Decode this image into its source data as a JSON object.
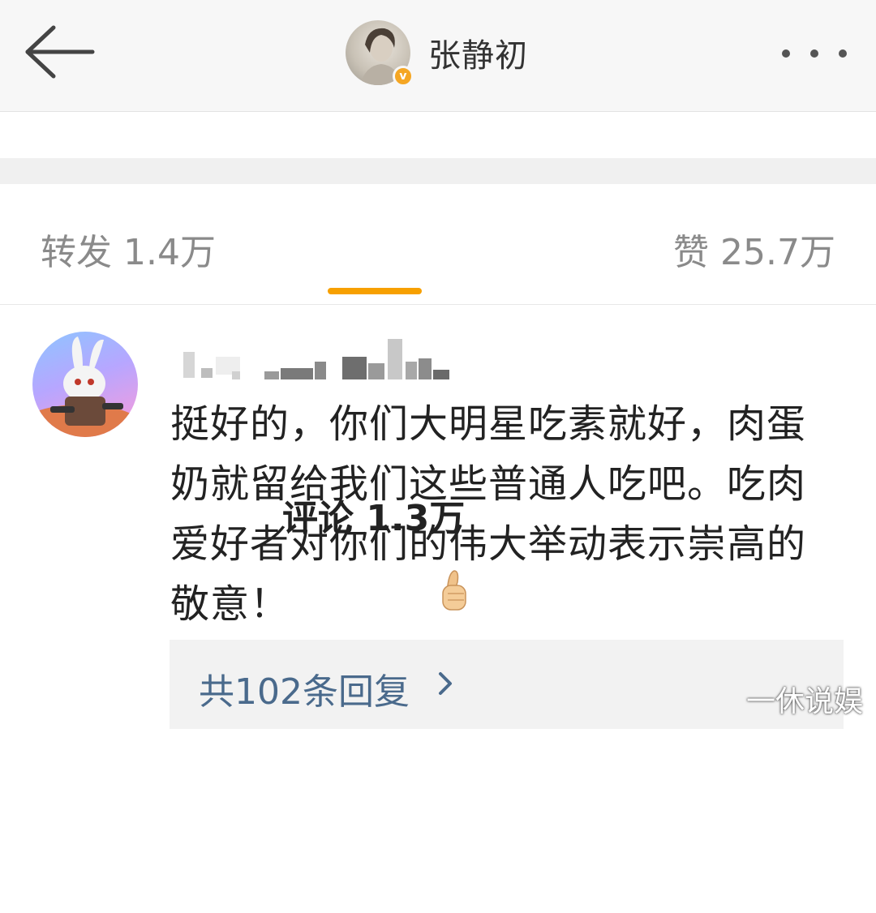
{
  "header": {
    "user_name": "张静初",
    "verified_mark": "v"
  },
  "tabs": {
    "repost": "转发 1.4万",
    "comment": "评论 1.3万",
    "like": "赞 25.7万"
  },
  "comment": {
    "text": "挺好的，你们大明星吃素就好，肉蛋奶就留给我们这些普通人吃吧。吃肉爱好者对你们的伟大举动表示崇高的敬意！",
    "replies_label": "共102条回复"
  },
  "watermark": "一休说娱",
  "colors": {
    "accent": "#f7a000",
    "link": "#4a6a8c",
    "verified": "#f5a623"
  }
}
